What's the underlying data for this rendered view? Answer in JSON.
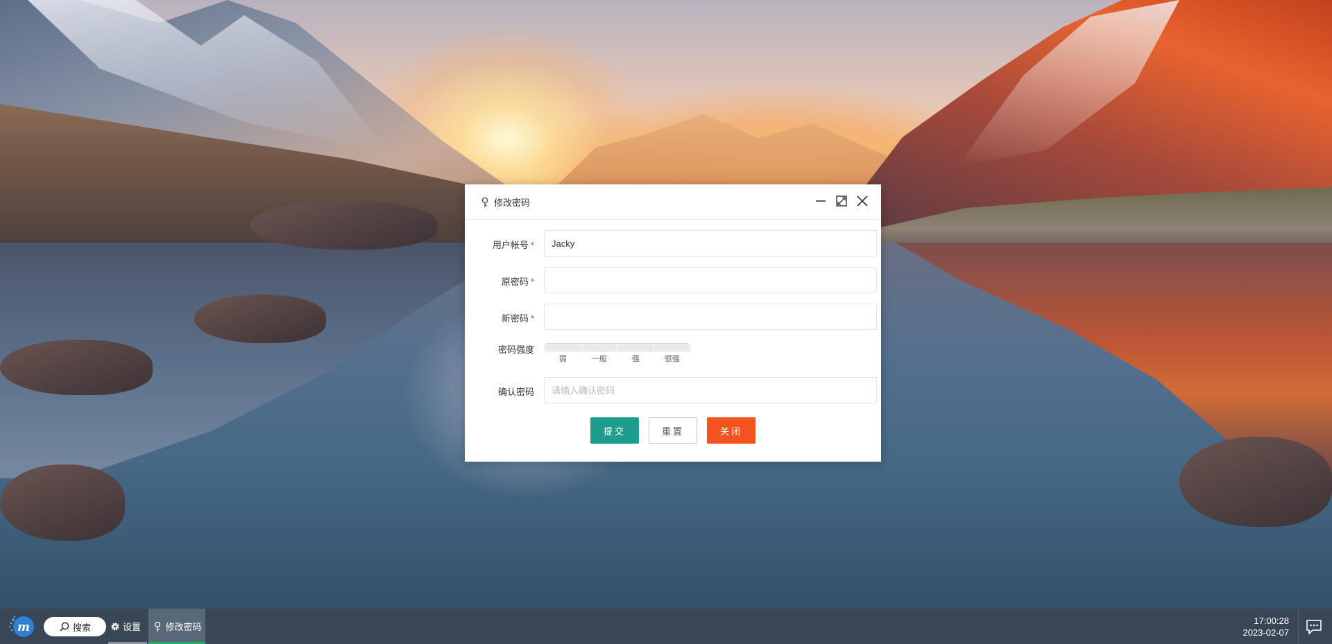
{
  "dialog": {
    "title": "修改密码",
    "icon": "key-icon",
    "controls": [
      "minimize-icon",
      "maximize-icon",
      "close-icon"
    ],
    "fields": {
      "username": {
        "label": "用户帐号",
        "required_mark": "*",
        "value": "Jacky"
      },
      "old_password": {
        "label": "原密码",
        "required_mark": "*",
        "value": ""
      },
      "new_password": {
        "label": "新密码",
        "required_mark": "*",
        "value": ""
      },
      "strength": {
        "label": "密码强度",
        "levels": [
          "弱",
          "一般",
          "强",
          "很强"
        ]
      },
      "confirm_password": {
        "label": "确认密码",
        "value": "",
        "placeholder": "请输入确认密码"
      }
    },
    "buttons": {
      "submit": "提交",
      "reset": "重置",
      "close": "关闭"
    },
    "colors": {
      "submit": "#1e9c8c",
      "close": "#f1541e",
      "required": "#e4393c"
    }
  },
  "taskbar": {
    "start_icon": "logo-m-icon",
    "search_label": "搜索",
    "settings_label": "设置",
    "open_window_label": "修改密码",
    "time": "17:00:28",
    "date": "2023-02-07",
    "notify_icon": "message-icon",
    "active_indicator_color": "#1eb35e"
  }
}
